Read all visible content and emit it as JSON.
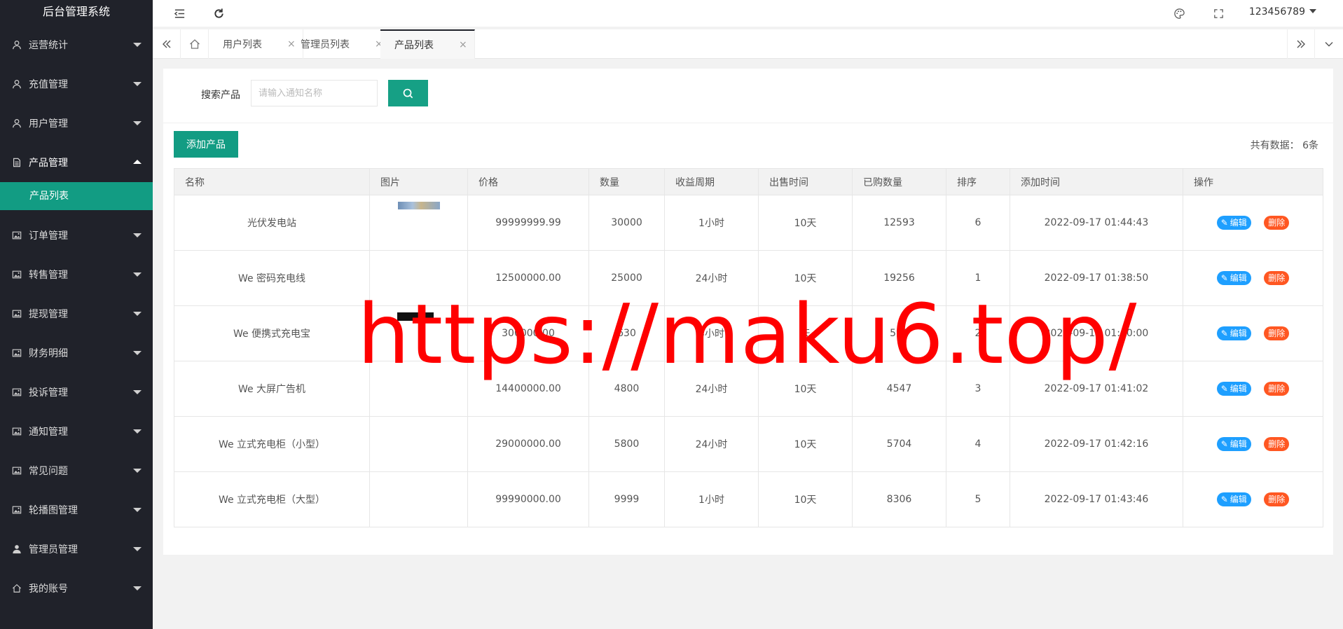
{
  "app": {
    "title": "后台管理系统"
  },
  "sidebar": {
    "items": [
      {
        "label": "运营统计",
        "icon": "user-icon"
      },
      {
        "label": "充值管理",
        "icon": "user-icon"
      },
      {
        "label": "用户管理",
        "icon": "user-icon"
      },
      {
        "label": "产品管理",
        "icon": "file-icon",
        "open": true
      },
      {
        "label": "订单管理",
        "icon": "image-icon"
      },
      {
        "label": "转售管理",
        "icon": "image-icon"
      },
      {
        "label": "提现管理",
        "icon": "image-icon"
      },
      {
        "label": "财务明细",
        "icon": "image-icon"
      },
      {
        "label": "投诉管理",
        "icon": "image-icon"
      },
      {
        "label": "通知管理",
        "icon": "image-icon"
      },
      {
        "label": "常见问题",
        "icon": "image-icon"
      },
      {
        "label": "轮播图管理",
        "icon": "image-icon"
      },
      {
        "label": "管理员管理",
        "icon": "person-icon"
      },
      {
        "label": "我的账号",
        "icon": "home-icon"
      }
    ],
    "sub_item": "产品列表"
  },
  "header": {
    "username": "123456789"
  },
  "tabs": [
    {
      "label": "用户列表",
      "close": "×"
    },
    {
      "label": "管理员列表",
      "close": "×"
    },
    {
      "label": "产品列表",
      "close": "×",
      "active": true
    }
  ],
  "search": {
    "label": "搜索产品",
    "placeholder": "请输入通知名称"
  },
  "toolbar": {
    "add_label": "添加产品",
    "count_text": "共有数据：  6条"
  },
  "table": {
    "headers": [
      "名称",
      "图片",
      "价格",
      "数量",
      "收益周期",
      "出售时间",
      "已购数量",
      "排序",
      "添加时间",
      "操作"
    ],
    "edit_label": "编辑",
    "delete_label": "删除",
    "rows": [
      {
        "name": "光伏发电站",
        "price": "99999999.99",
        "qty": "30000",
        "cycle": "1小时",
        "sale": "10天",
        "bought": "12593",
        "sort": "6",
        "added": "2022-09-17 01:44:43"
      },
      {
        "name": "We 密码充电线",
        "price": "12500000.00",
        "qty": "25000",
        "cycle": "24小时",
        "sale": "10天",
        "bought": "19256",
        "sort": "1",
        "added": "2022-09-17 01:38:50"
      },
      {
        "name": "We 便携式充电宝",
        "price": "300000.00",
        "qty": "630",
        "cycle": "4小时",
        "sale": "天",
        "bought": "591",
        "sort": "2",
        "added": "2022-09-17 01:40:00"
      },
      {
        "name": "We 大屏广告机",
        "price": "14400000.00",
        "qty": "4800",
        "cycle": "24小时",
        "sale": "10天",
        "bought": "4547",
        "sort": "3",
        "added": "2022-09-17 01:41:02"
      },
      {
        "name": "We 立式充电柜（小型）",
        "price": "29000000.00",
        "qty": "5800",
        "cycle": "24小时",
        "sale": "10天",
        "bought": "5704",
        "sort": "4",
        "added": "2022-09-17 01:42:16"
      },
      {
        "name": "We 立式充电柜（大型）",
        "price": "99990000.00",
        "qty": "9999",
        "cycle": "1小时",
        "sale": "10天",
        "bought": "8306",
        "sort": "5",
        "added": "2022-09-17 01:43:46"
      }
    ]
  },
  "watermark": "https://maku6.top/",
  "colors": {
    "sidebar_bg": "#20222a",
    "accent": "#129c83",
    "edit": "#1e9fff",
    "delete": "#ff5722",
    "watermark": "#ff0000"
  }
}
